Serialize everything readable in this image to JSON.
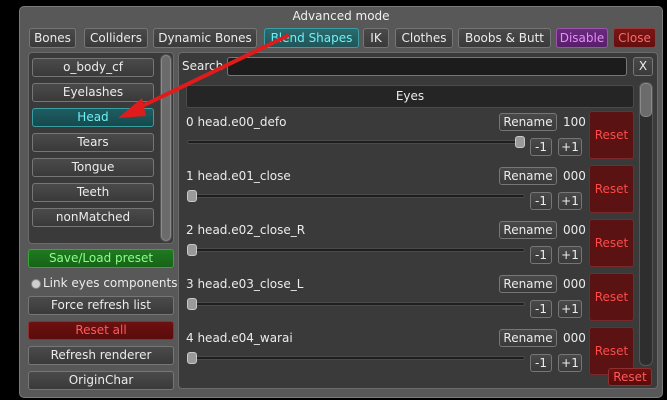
{
  "window": {
    "title": "Advanced mode"
  },
  "tabs": [
    {
      "label": "Bones",
      "name": "tab-bones"
    },
    {
      "label": "Colliders",
      "name": "tab-colliders"
    },
    {
      "label": "Dynamic Bones",
      "name": "tab-dynamic-bones"
    },
    {
      "label": "Blend Shapes",
      "name": "tab-blend-shapes"
    },
    {
      "label": "IK",
      "name": "tab-ik"
    },
    {
      "label": "Clothes",
      "name": "tab-clothes"
    },
    {
      "label": "Boobs & Butt",
      "name": "tab-boobs-butt"
    },
    {
      "label": "Disable",
      "name": "disable-button"
    },
    {
      "label": "Close",
      "name": "close-button"
    }
  ],
  "sidebar": {
    "items": [
      {
        "label": "o_body_cf"
      },
      {
        "label": "Eyelashes"
      },
      {
        "label": "Head"
      },
      {
        "label": "Tears"
      },
      {
        "label": "Tongue"
      },
      {
        "label": "Teeth"
      },
      {
        "label": "nonMatched"
      }
    ],
    "save_load": "Save/Load preset",
    "link_eyes": "Link eyes components",
    "force_refresh": "Force refresh list",
    "reset_all": "Reset all",
    "refresh_renderer": "Refresh renderer",
    "origin_char": "OriginChar"
  },
  "search": {
    "label": "Search",
    "value": "",
    "clear": "X"
  },
  "group": {
    "title": "Eyes"
  },
  "shapes": [
    {
      "label": "0 head.e00_defo",
      "value": "100",
      "level": 1.0
    },
    {
      "label": "1 head.e01_close",
      "value": "000",
      "level": 0.0
    },
    {
      "label": "2 head.e02_close_R",
      "value": "000",
      "level": 0.0
    },
    {
      "label": "3 head.e03_close_L",
      "value": "000",
      "level": 0.0
    },
    {
      "label": "4 head.e04_warai",
      "value": "000",
      "level": 0.0
    }
  ],
  "shape_controls": {
    "rename": "Rename",
    "minus": "-1",
    "plus": "+1",
    "reset": "Reset"
  },
  "bottom": {
    "reset": "Reset"
  },
  "colors": {
    "accent": "#6ff0f4",
    "reset_red": "#ff4a4a",
    "arrow": "#e01b1b"
  }
}
